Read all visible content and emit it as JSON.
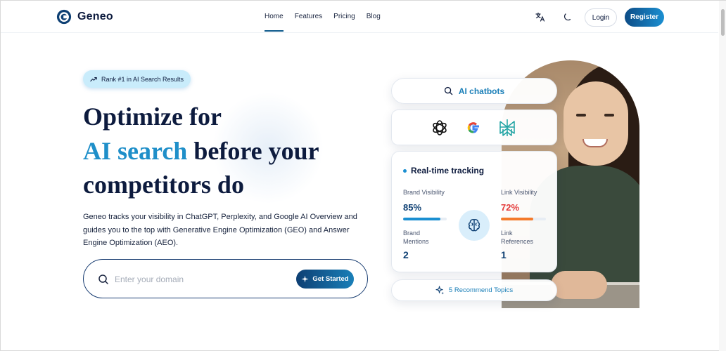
{
  "brand": {
    "name": "Geneo"
  },
  "nav": {
    "items": [
      "Home",
      "Features",
      "Pricing",
      "Blog"
    ],
    "active": "Home"
  },
  "header": {
    "translate_icon": "translate-icon",
    "theme_icon": "moon-icon",
    "login_label": "Login",
    "register_label": "Register"
  },
  "hero": {
    "badge": "Rank #1 in AI Search Results",
    "headline_line1": "Optimize for",
    "headline_accent": "AI search",
    "headline_line2_rest": " before your",
    "headline_line3": "competitors do",
    "description": "Geneo tracks your visibility in ChatGPT, Perplexity, and Google AI Overview and guides you to the top with Generative Engine Optimization (GEO) and Answer Engine Optimization (AEO).",
    "search_placeholder": "Enter your domain",
    "search_value": "",
    "cta_label": "Get Started"
  },
  "panel": {
    "chatbots_label": "AI chatbots",
    "logos": [
      "openai-icon",
      "google-icon",
      "perplexity-icon"
    ],
    "tracking_title": "Real-time tracking",
    "brand_visibility_label": "Brand Visibility",
    "brand_visibility_value": "85%",
    "brand_visibility_fill": 0.85,
    "link_visibility_label": "Link Visibility",
    "link_visibility_value": "72%",
    "link_visibility_fill": 0.72,
    "brand_mentions_label": "Brand\nMentions",
    "brand_mentions_value": "2",
    "link_references_label": "Link\nReferences",
    "link_references_value": "1",
    "topics_label": "5 Recommend Topics"
  },
  "colors": {
    "navy": "#0d1b3e",
    "accent": "#1f8fc9",
    "brand_bar": "#1a8fd1",
    "link_bar": "#f47a2b",
    "link_value": "#e43b3b"
  }
}
